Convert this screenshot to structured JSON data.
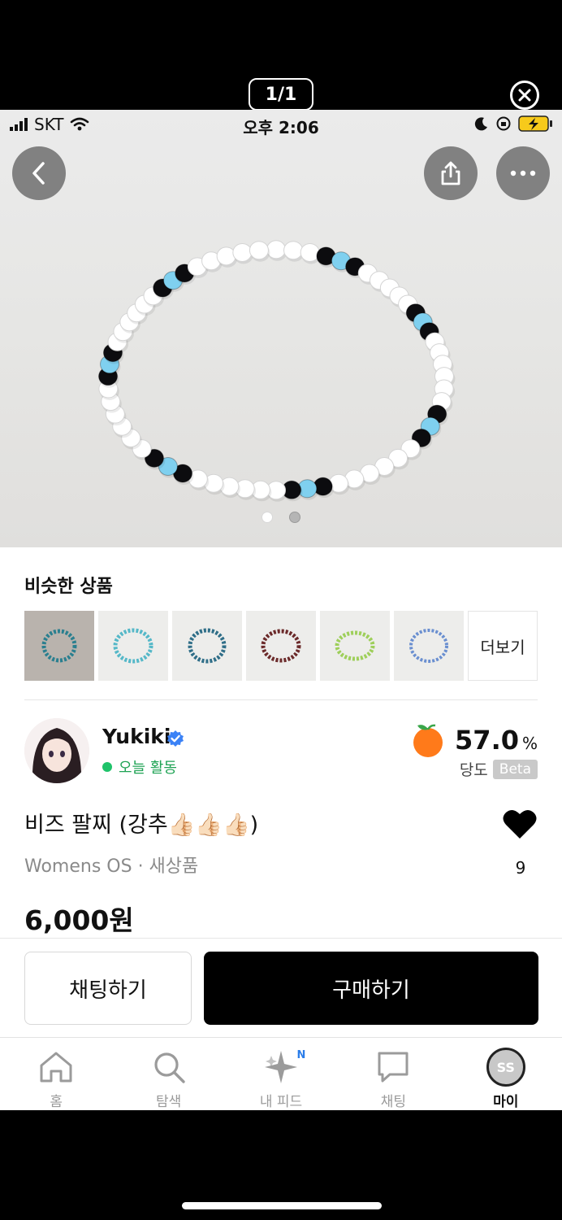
{
  "viewer": {
    "counter": "1/1"
  },
  "status_bar": {
    "carrier": "SKT",
    "time": "오후 2:06"
  },
  "photo": {
    "page_dots": 2,
    "active_dot": 0
  },
  "similar": {
    "title": "비슷한 상품",
    "more_label": "더보기",
    "thumb_colors": [
      "#2a7f8f",
      "#55b8c8",
      "#2f6e88",
      "#6b2a2a",
      "#9ecf5a",
      "#6a8fd0"
    ]
  },
  "seller": {
    "name": "Yukiki",
    "activity": "오늘 활동",
    "sweet_score": "57.0",
    "sweet_unit": "%",
    "sweet_label": "당도",
    "beta": "Beta"
  },
  "product": {
    "title": "비즈 팔찌 (강추👍🏻👍🏻👍🏻)",
    "meta": "Womens OS · 새상품",
    "likes": "9",
    "price": "6,000원"
  },
  "actions": {
    "chat": "채팅하기",
    "buy": "구매하기"
  },
  "tabs": [
    {
      "label": "홈",
      "icon": "home-icon"
    },
    {
      "label": "탐색",
      "icon": "search-icon"
    },
    {
      "label": "내 피드",
      "icon": "sparkle-icon",
      "badge": "N"
    },
    {
      "label": "채팅",
      "icon": "chat-icon"
    },
    {
      "label": "마이",
      "icon": "avatar",
      "avatar_text": "SS"
    }
  ],
  "colors": {
    "accent_green": "#1fc36a",
    "verified_blue": "#3b82f6",
    "buy_button": "#000000"
  }
}
